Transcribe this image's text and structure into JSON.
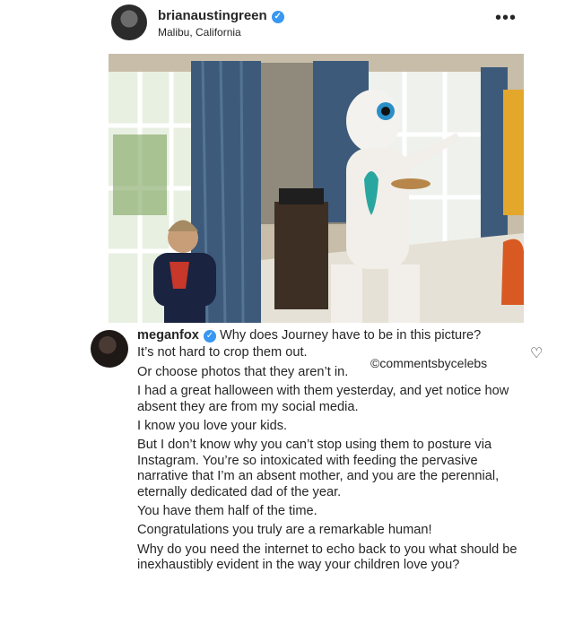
{
  "post": {
    "username": "brianaustingreen",
    "location": "Malibu, California",
    "more_label": "•••",
    "verified_icon": "verified-check-icon"
  },
  "comment": {
    "username": "meganfox",
    "first_line": "Why does Journey have to be in this picture?",
    "paragraphs": [
      "It’s not hard to crop them out.",
      "Or choose photos that they aren’t in.",
      "I had a great halloween with them yesterday, and yet notice how absent they are from my social media.",
      "I know you love your kids.",
      "But I don’t know why you can’t stop using them to posture via Instagram. You’re so intoxicated with feeding the pervasive narrative that I’m an absent mother, and you are the perennial, eternally dedicated dad of the year.",
      "You have them half of the time.",
      "Congratulations you truly are a remarkable human!",
      "Why do you need the internet to echo back to you what should be inexhaustibly evident in the way your children love you?"
    ],
    "watermark": "©commentsbycelebs",
    "like_icon": "heart-outline-icon"
  },
  "colors": {
    "verified": "#3897f0",
    "text": "#262626"
  }
}
